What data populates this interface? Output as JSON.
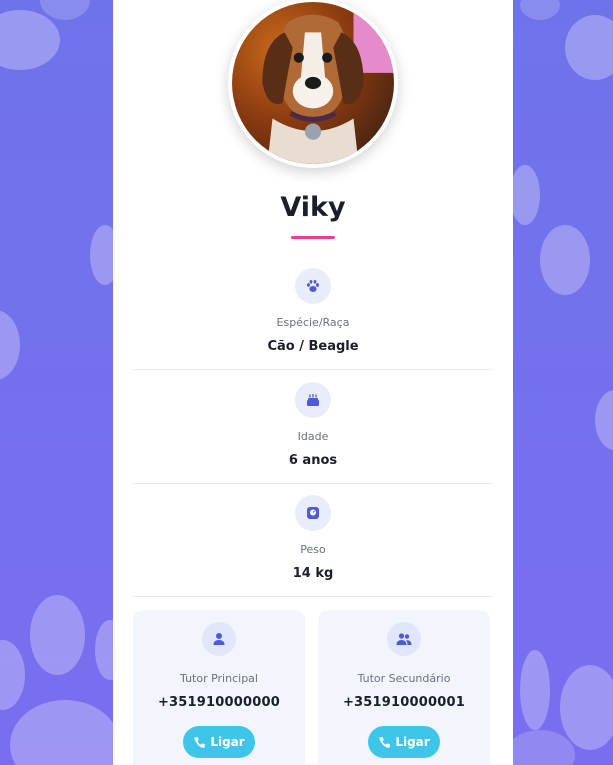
{
  "pet": {
    "name": "Viky",
    "photo_alt": "Viky"
  },
  "info": [
    {
      "icon": "paw-icon",
      "label": "Espécie/Raça",
      "value": "Cão / Beagle"
    },
    {
      "icon": "birthday-cake-icon",
      "label": "Idade",
      "value": "6 anos"
    },
    {
      "icon": "weight-scale-icon",
      "label": "Peso",
      "value": "14 kg"
    }
  ],
  "tutors": [
    {
      "icon": "user-icon",
      "label": "Tutor Principal",
      "phone": "+351910000000",
      "call_label": "Ligar"
    },
    {
      "icon": "users-icon",
      "label": "Tutor Secundário",
      "phone": "+351910000001",
      "call_label": "Ligar"
    }
  ],
  "colors": {
    "background": "#7371ee",
    "accent": "#ea3f8f",
    "call_button": "#3ec6ea",
    "icon": "#4e5bd8"
  }
}
